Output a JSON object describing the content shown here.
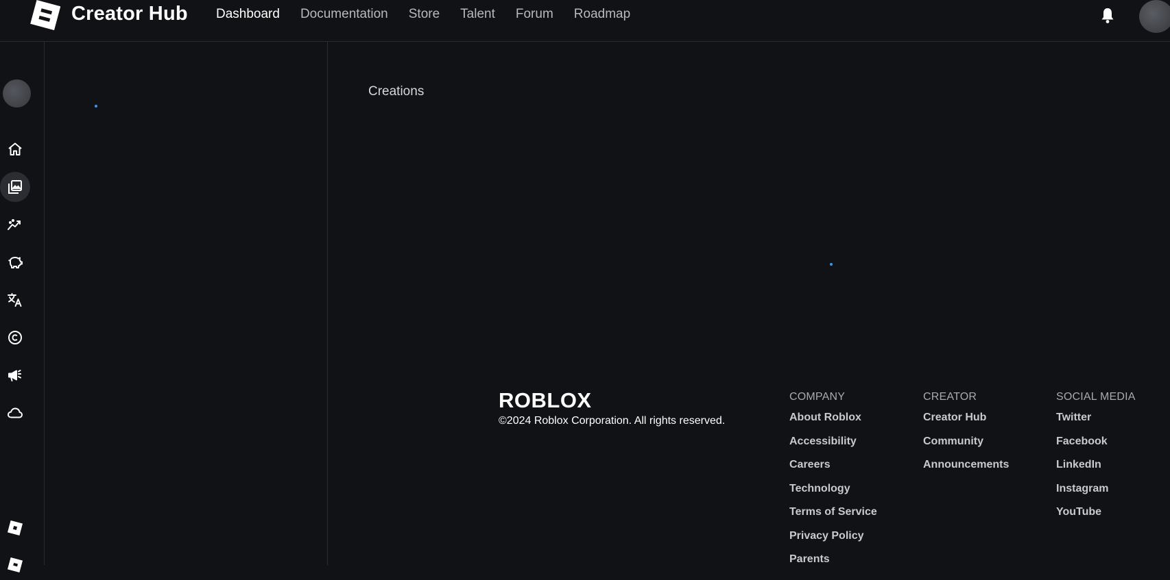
{
  "header": {
    "brand": "Creator Hub",
    "nav": [
      {
        "label": "Dashboard",
        "active": true
      },
      {
        "label": "Documentation",
        "active": false
      },
      {
        "label": "Store",
        "active": false
      },
      {
        "label": "Talent",
        "active": false
      },
      {
        "label": "Forum",
        "active": false
      },
      {
        "label": "Roadmap",
        "active": false
      }
    ],
    "icons": [
      "creator-hub-logo-icon",
      "bell-icon",
      "user-avatar"
    ]
  },
  "rail": {
    "items": [
      {
        "icon": "home-icon"
      },
      {
        "icon": "creations-gallery-icon",
        "active": true
      },
      {
        "icon": "analytics-icon"
      },
      {
        "icon": "monetization-piggy-bank-icon"
      },
      {
        "icon": "localization-translate-icon"
      },
      {
        "icon": "copyright-icon"
      },
      {
        "icon": "advertising-megaphone-icon"
      },
      {
        "icon": "cloud-icon"
      },
      {
        "icon": "roblox-tile-icon"
      }
    ]
  },
  "main": {
    "title": "Creations"
  },
  "footer": {
    "logo_text": "ROBLOX",
    "copyright": "©2024 Roblox Corporation. All rights reserved.",
    "columns": [
      {
        "heading": "COMPANY",
        "links": [
          "About Roblox",
          "Accessibility",
          "Careers",
          "Technology",
          "Terms of Service",
          "Privacy Policy",
          "Parents"
        ]
      },
      {
        "heading": "CREATOR",
        "links": [
          "Creator Hub",
          "Community",
          "Announcements"
        ]
      },
      {
        "heading": "SOCIAL MEDIA",
        "links": [
          "Twitter",
          "Facebook",
          "LinkedIn",
          "Instagram",
          "YouTube"
        ]
      }
    ]
  },
  "colors": {
    "background": "#111216",
    "divider": "#2a2c31",
    "spinner": "#2f9bff"
  }
}
